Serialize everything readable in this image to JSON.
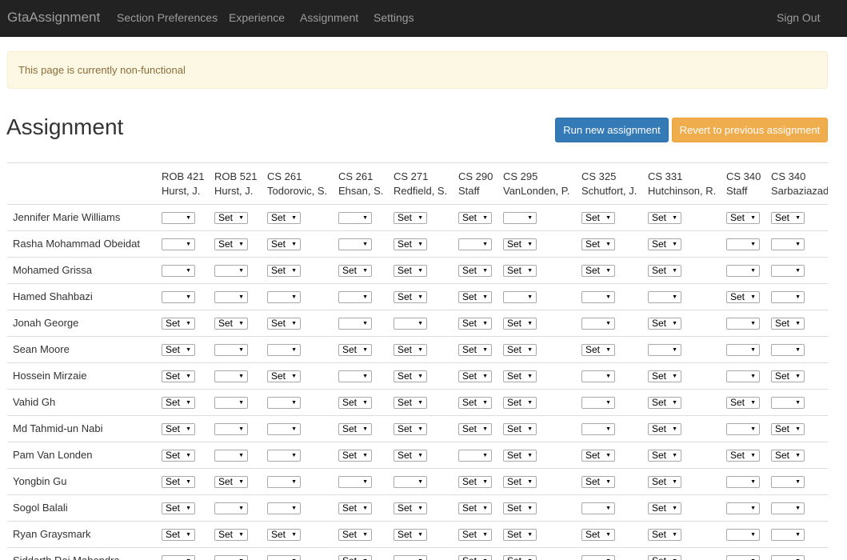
{
  "nav": {
    "brand": "GtaAssignment",
    "links": [
      "Section Preferences",
      "Experience",
      "Assignment",
      "Settings"
    ],
    "sign_out": "Sign Out"
  },
  "alert": "This page is currently non-functional",
  "page_title": "Assignment",
  "buttons": {
    "run": "Run new assignment",
    "revert": "Revert to previous assignment"
  },
  "columns": [
    {
      "course": "ROB 421",
      "instructor": "Hurst, J."
    },
    {
      "course": "ROB 521",
      "instructor": "Hurst, J."
    },
    {
      "course": "CS 261",
      "instructor": "Todorovic, S."
    },
    {
      "course": "CS 261",
      "instructor": "Ehsan, S."
    },
    {
      "course": "CS 271",
      "instructor": "Redfield, S."
    },
    {
      "course": "CS 290",
      "instructor": "Staff"
    },
    {
      "course": "CS 295",
      "instructor": "VanLonden, P."
    },
    {
      "course": "CS 325",
      "instructor": "Schutfort, J."
    },
    {
      "course": "CS 331",
      "instructor": "Hutchinson, R."
    },
    {
      "course": "CS 340",
      "instructor": "Staff"
    },
    {
      "course": "CS 340",
      "instructor": "Sarbaziazad,"
    }
  ],
  "set_label": "Set",
  "rows": [
    {
      "name": "Jennifer Marie Williams",
      "cells": [
        0,
        1,
        1,
        0,
        1,
        1,
        0,
        1,
        1,
        1,
        1
      ]
    },
    {
      "name": "Rasha Mohammad Obeidat",
      "cells": [
        0,
        1,
        1,
        0,
        1,
        0,
        1,
        1,
        1,
        0,
        0
      ]
    },
    {
      "name": "Mohamed Grissa",
      "cells": [
        0,
        0,
        1,
        1,
        1,
        1,
        1,
        1,
        1,
        0,
        0
      ]
    },
    {
      "name": "Hamed Shahbazi",
      "cells": [
        0,
        0,
        0,
        0,
        1,
        1,
        0,
        0,
        0,
        1,
        0
      ]
    },
    {
      "name": "Jonah George",
      "cells": [
        1,
        1,
        1,
        0,
        0,
        1,
        1,
        0,
        1,
        0,
        1
      ]
    },
    {
      "name": "Sean Moore",
      "cells": [
        1,
        0,
        0,
        1,
        1,
        1,
        1,
        1,
        0,
        0,
        0
      ]
    },
    {
      "name": "Hossein Mirzaie",
      "cells": [
        1,
        0,
        1,
        0,
        1,
        1,
        1,
        0,
        1,
        0,
        1
      ]
    },
    {
      "name": "Vahid Gh",
      "cells": [
        1,
        0,
        0,
        1,
        1,
        1,
        1,
        0,
        1,
        1,
        0
      ]
    },
    {
      "name": "Md Tahmid-un Nabi",
      "cells": [
        1,
        0,
        0,
        1,
        1,
        1,
        1,
        0,
        1,
        0,
        1
      ]
    },
    {
      "name": "Pam Van Londen",
      "cells": [
        1,
        0,
        0,
        1,
        1,
        0,
        1,
        1,
        1,
        1,
        1
      ]
    },
    {
      "name": "Yongbin Gu",
      "cells": [
        1,
        1,
        0,
        0,
        0,
        1,
        1,
        1,
        1,
        0,
        0
      ]
    },
    {
      "name": "Sogol Balali",
      "cells": [
        1,
        0,
        0,
        1,
        1,
        1,
        1,
        0,
        1,
        0,
        0
      ]
    },
    {
      "name": "Ryan Graysmark",
      "cells": [
        1,
        1,
        1,
        1,
        1,
        1,
        1,
        1,
        1,
        0,
        0
      ]
    },
    {
      "name": "Siddarth Raj Mahendra",
      "cells": [
        0,
        0,
        0,
        1,
        0,
        1,
        1,
        0,
        1,
        0,
        0
      ]
    }
  ]
}
